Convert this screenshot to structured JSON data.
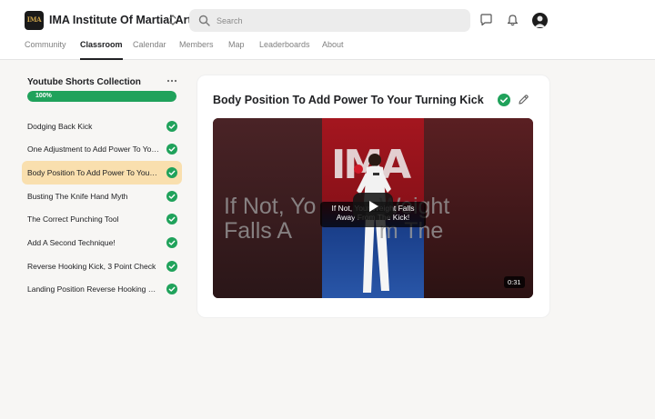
{
  "header": {
    "logo_text": "IMA",
    "org_name": "IMA Institute Of Martial Arts",
    "search_placeholder": "Search"
  },
  "nav": {
    "tabs": [
      {
        "label": "Community",
        "active": false
      },
      {
        "label": "Classroom",
        "active": true
      },
      {
        "label": "Calendar",
        "active": false
      },
      {
        "label": "Members",
        "active": false
      },
      {
        "label": "Map",
        "active": false
      },
      {
        "label": "Leaderboards",
        "active": false
      },
      {
        "label": "About",
        "active": false
      }
    ]
  },
  "course": {
    "title": "Youtube Shorts Collection",
    "progress_label": "100%",
    "progress_percent": 100,
    "lessons": [
      {
        "label": "Dodging Back Kick",
        "completed": true,
        "active": false
      },
      {
        "label": "One Adjustment to Add Power To Your Turning Kick",
        "completed": true,
        "active": false
      },
      {
        "label": "Body Position To Add Power To Your Turning Kick",
        "completed": true,
        "active": true
      },
      {
        "label": "Busting The Knife Hand Myth",
        "completed": true,
        "active": false
      },
      {
        "label": "The Correct Punching Tool",
        "completed": true,
        "active": false
      },
      {
        "label": "Add A Second Technique!",
        "completed": true,
        "active": false
      },
      {
        "label": "Reverse Hooking Kick, 3 Point Check",
        "completed": true,
        "active": false
      },
      {
        "label": "Landing Position Reverse Hooking Kick",
        "completed": true,
        "active": false
      }
    ]
  },
  "main": {
    "lesson_title": "Body Position To Add Power To Your Turning Kick",
    "video": {
      "big_caption": "If Not, Yo          Weight\nFalls A              m The",
      "small_caption": "If Not, Your Weight Falls Away From The Kick!",
      "duration": "0:31",
      "ima_letters": "IMA"
    }
  },
  "colors": {
    "accent_green": "#20a25b",
    "active_lesson_bg": "#f9dfae"
  }
}
